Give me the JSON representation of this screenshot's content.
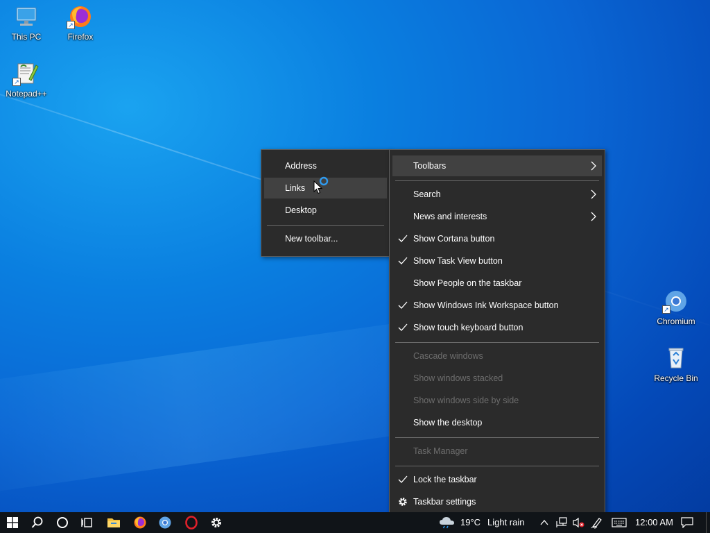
{
  "desktop": {
    "icons": [
      {
        "label": "This PC",
        "icon": "this-pc-icon"
      },
      {
        "label": "Firefox",
        "icon": "firefox-icon"
      },
      {
        "label": "Notepad++",
        "icon": "notepad-plus-plus-icon"
      },
      {
        "label": "Chromium",
        "icon": "chromium-icon"
      },
      {
        "label": "Recycle Bin",
        "icon": "recycle-bin-icon"
      }
    ]
  },
  "toolbars_submenu": {
    "items": [
      {
        "label": "Address"
      },
      {
        "label": "Links",
        "highlighted": true
      },
      {
        "label": "Desktop"
      },
      {
        "label": "New toolbar..."
      }
    ]
  },
  "context_menu": {
    "items": [
      {
        "label": "Toolbars",
        "has_submenu": true,
        "highlighted": true
      },
      {
        "label": "Search",
        "has_submenu": true
      },
      {
        "label": "News and interests",
        "has_submenu": true
      },
      {
        "label": "Show Cortana button",
        "checked": true
      },
      {
        "label": "Show Task View button",
        "checked": true
      },
      {
        "label": "Show People on the taskbar",
        "checked": false
      },
      {
        "label": "Show Windows Ink Workspace button",
        "checked": true
      },
      {
        "label": "Show touch keyboard button",
        "checked": true
      },
      {
        "label": "Cascade windows",
        "disabled": true
      },
      {
        "label": "Show windows stacked",
        "disabled": true
      },
      {
        "label": "Show windows side by side",
        "disabled": true
      },
      {
        "label": "Show the desktop"
      },
      {
        "label": "Task Manager",
        "disabled": true
      },
      {
        "label": "Lock the taskbar",
        "checked": true
      },
      {
        "label": "Taskbar settings",
        "icon": "gear-icon"
      }
    ]
  },
  "taskbar": {
    "buttons": [
      "start-icon",
      "search-icon",
      "cortana-icon",
      "task-view-icon",
      "file-explorer-icon",
      "firefox-icon",
      "chromium-icon",
      "opera-icon",
      "settings-icon"
    ],
    "weather": {
      "temperature": "19°C",
      "condition": "Light rain"
    },
    "clock": "12:00 AM"
  },
  "colors": {
    "menu_bg": "#2b2b2b",
    "menu_hover": "#414141",
    "disabled_text": "#6d6d6d",
    "taskbar_bg": "#101418",
    "accent_blue": "#0a66d4"
  }
}
